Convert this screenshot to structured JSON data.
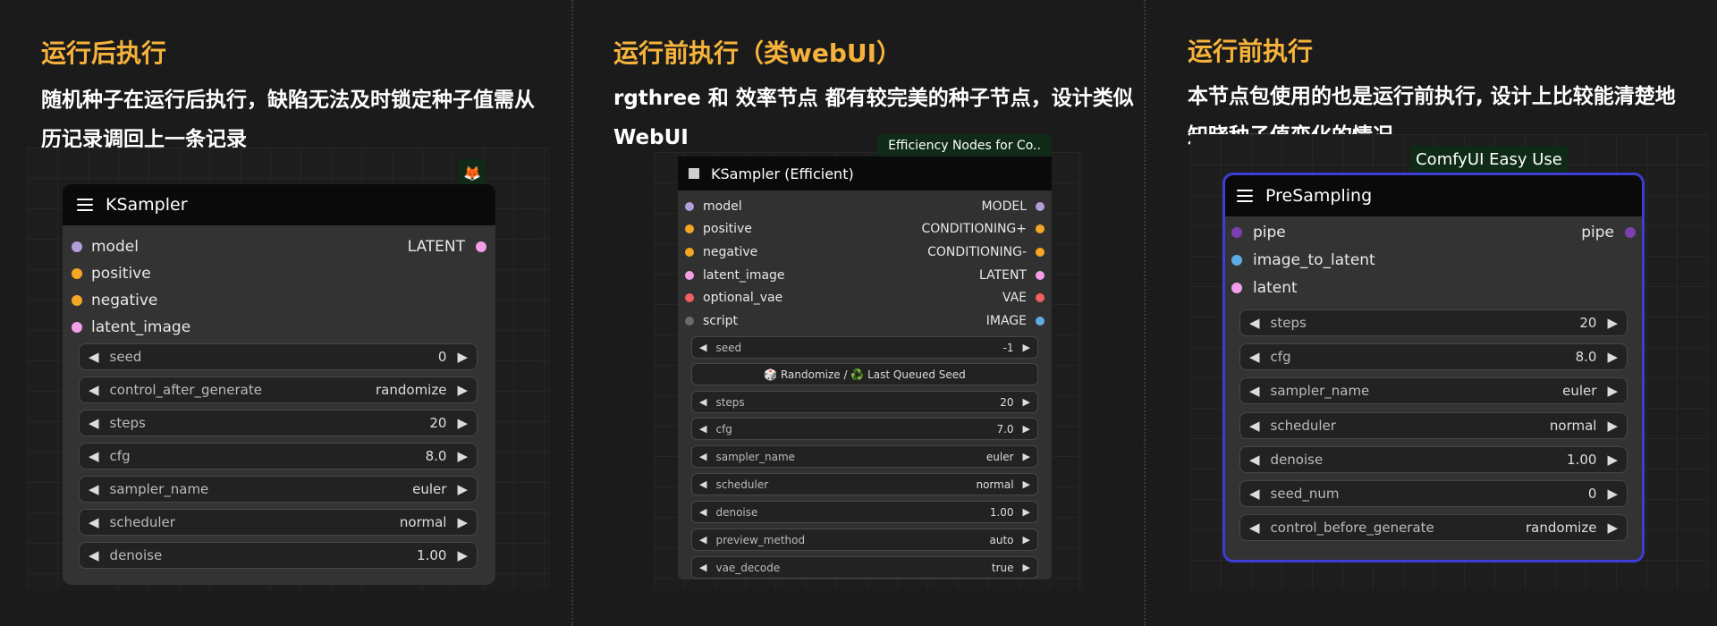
{
  "panels": [
    {
      "heading": "运行后执行",
      "desc_lines": [
        "随机种子在运行后执行，缺陷无法及时锁定种子值需从",
        "历记录调回上一条记录"
      ],
      "node": {
        "badge_icon": "🦊",
        "title": "KSampler",
        "inputs": [
          {
            "name": "model",
            "color": "#b39ddb"
          },
          {
            "name": "positive",
            "color": "#f5a623"
          },
          {
            "name": "negative",
            "color": "#f5a623"
          },
          {
            "name": "latent_image",
            "color": "#f59ee8"
          }
        ],
        "outputs": [
          {
            "name": "LATENT",
            "color": "#f59ee8"
          }
        ],
        "widgets": [
          {
            "label": "seed",
            "value": "0"
          },
          {
            "label": "control_after_generate",
            "value": "randomize"
          },
          {
            "label": "steps",
            "value": "20"
          },
          {
            "label": "cfg",
            "value": "8.0"
          },
          {
            "label": "sampler_name",
            "value": "euler"
          },
          {
            "label": "scheduler",
            "value": "normal"
          },
          {
            "label": "denoise",
            "value": "1.00"
          }
        ]
      }
    },
    {
      "heading": "运行前执行（类webUI）",
      "desc_lines": [
        "rgthree 和 效率节点 都有较完美的种子节点，设计类似",
        "WebUI"
      ],
      "node": {
        "badge": "Efficiency Nodes for Co..",
        "title": "KSampler (Efficient)",
        "inputs": [
          {
            "name": "model",
            "color": "#b39ddb"
          },
          {
            "name": "positive",
            "color": "#f5a623"
          },
          {
            "name": "negative",
            "color": "#f5a623"
          },
          {
            "name": "latent_image",
            "color": "#f59ee8"
          },
          {
            "name": "optional_vae",
            "color": "#f06060"
          },
          {
            "name": "script",
            "color": "#6b6b6b"
          }
        ],
        "outputs": [
          {
            "name": "MODEL",
            "color": "#b39ddb"
          },
          {
            "name": "CONDITIONING+",
            "color": "#f5a623"
          },
          {
            "name": "CONDITIONING-",
            "color": "#f5a623"
          },
          {
            "name": "LATENT",
            "color": "#f59ee8"
          },
          {
            "name": "VAE",
            "color": "#f06060"
          },
          {
            "name": "IMAGE",
            "color": "#5dade2"
          }
        ],
        "widgets": [
          {
            "label": "seed",
            "value": "-1"
          },
          {
            "button": "🎲 Randomize / ♻️ Last Queued Seed"
          },
          {
            "label": "steps",
            "value": "20"
          },
          {
            "label": "cfg",
            "value": "7.0"
          },
          {
            "label": "sampler_name",
            "value": "euler"
          },
          {
            "label": "scheduler",
            "value": "normal"
          },
          {
            "label": "denoise",
            "value": "1.00"
          },
          {
            "label": "preview_method",
            "value": "auto"
          },
          {
            "label": "vae_decode",
            "value": "true"
          }
        ]
      }
    },
    {
      "heading": "运行前执行",
      "desc_lines": [
        "本节点包使用的也是运行前执行, 设计上比较能清楚地",
        "知晓种子值变化的情况"
      ],
      "node": {
        "badge": "ComfyUI Easy Use",
        "title": "PreSampling",
        "inputs": [
          {
            "name": "pipe",
            "color": "#7b3fb0"
          },
          {
            "name": "image_to_latent",
            "color": "#5dade2"
          },
          {
            "name": "latent",
            "color": "#f59ee8"
          }
        ],
        "outputs": [
          {
            "name": "pipe",
            "color": "#7b3fb0"
          }
        ],
        "widgets": [
          {
            "label": "steps",
            "value": "20"
          },
          {
            "label": "cfg",
            "value": "8.0"
          },
          {
            "label": "sampler_name",
            "value": "euler"
          },
          {
            "label": "scheduler",
            "value": "normal"
          },
          {
            "label": "denoise",
            "value": "1.00"
          },
          {
            "label": "seed_num",
            "value": "0"
          },
          {
            "label": "control_before_generate",
            "value": "randomize"
          }
        ]
      }
    }
  ]
}
